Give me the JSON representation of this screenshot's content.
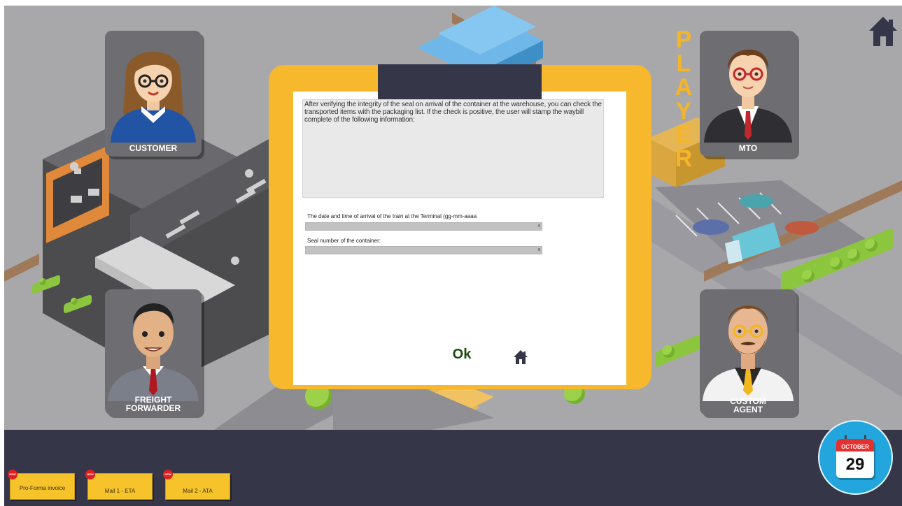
{
  "characters": {
    "customer": "CUSTOMER",
    "mto": "MTO",
    "freight_forwarder_line1": "FREIGHT",
    "freight_forwarder_line2": "FORWARDER",
    "custom_agent_line1": "CUSTOM",
    "custom_agent_line2": "AGENT"
  },
  "player_letters": [
    "P",
    "L",
    "A",
    "Y",
    "E",
    "R"
  ],
  "dialog": {
    "description": "After verifying the integrity of the seal on arrival of the container at the warehouse, you can check the transported items with the packaging list. If the check is positive, the user will stamp the waybill complete of the following information:",
    "field1_label": "The date and time of arrival of the train at the Terminal (gg-mm-aaaa",
    "field1_value": "",
    "field2_label": "Seal number of the container:",
    "field2_value": "",
    "ok_label": "Ok"
  },
  "documents": [
    {
      "label": "Pro-Forma invoice",
      "badge": "NEW"
    },
    {
      "label": "Mail 1 - ETA",
      "badge": "NEW"
    },
    {
      "label": "Mail 2 - ATA",
      "badge": "NEW"
    }
  ],
  "calendar": {
    "month": "OCTOBER",
    "day": "29"
  },
  "colors": {
    "dialog_frame": "#f8b82e",
    "bottom_bar": "#363649",
    "ok_text": "#1e4a12",
    "calendar_circle": "#22a6dd",
    "calendar_header": "#e4302f",
    "player_text": "#f5b52a"
  },
  "icons": {
    "home": "home-icon",
    "calendar": "calendar-icon"
  }
}
